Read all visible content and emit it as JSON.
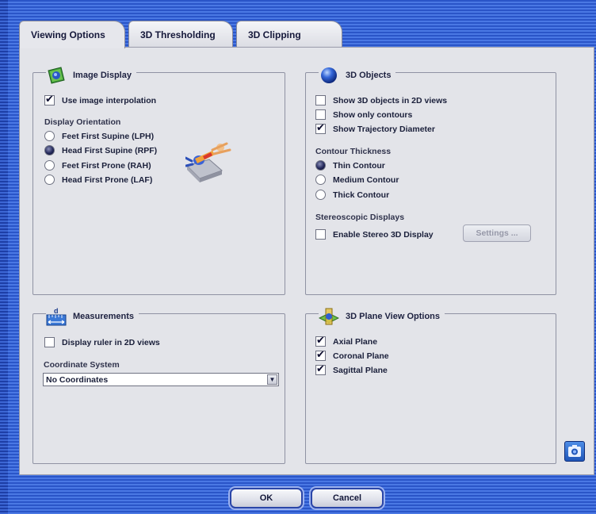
{
  "tabs": [
    {
      "label": "Viewing Options",
      "active": true
    },
    {
      "label": "3D Thresholding",
      "active": false
    },
    {
      "label": "3D Clipping",
      "active": false
    }
  ],
  "image_display": {
    "title": "Image Display",
    "interpolation": {
      "label": "Use image interpolation",
      "checked": true
    },
    "orientation_label": "Display Orientation",
    "orientations": [
      {
        "label": "Feet First Supine (LPH)",
        "selected": false
      },
      {
        "label": "Head First Supine (RPF)",
        "selected": true
      },
      {
        "label": "Feet First Prone (RAH)",
        "selected": false
      },
      {
        "label": "Head First Prone (LAF)",
        "selected": false
      }
    ]
  },
  "objects_3d": {
    "title": "3D Objects",
    "options": [
      {
        "label": "Show 3D objects in 2D views",
        "checked": false
      },
      {
        "label": "Show only contours",
        "checked": false
      },
      {
        "label": "Show Trajectory Diameter",
        "checked": true
      }
    ],
    "contour_label": "Contour Thickness",
    "contours": [
      {
        "label": "Thin Contour",
        "selected": true
      },
      {
        "label": "Medium Contour",
        "selected": false
      },
      {
        "label": "Thick Contour",
        "selected": false
      }
    ],
    "stereo_label": "Stereoscopic Displays",
    "stereo": {
      "label": "Enable Stereo 3D Display",
      "checked": false
    },
    "settings_button": "Settings ..."
  },
  "measurements": {
    "title": "Measurements",
    "ruler": {
      "label": "Display ruler in 2D views",
      "checked": false
    },
    "coord_label": "Coordinate System",
    "coord_value": "No Coordinates"
  },
  "plane_view": {
    "title": "3D Plane View Options",
    "planes": [
      {
        "label": "Axial Plane",
        "checked": true
      },
      {
        "label": "Coronal Plane",
        "checked": true
      },
      {
        "label": "Sagittal Plane",
        "checked": true
      }
    ]
  },
  "footer": {
    "ok": "OK",
    "cancel": "Cancel"
  },
  "icons": {
    "image_display": "image-display-icon",
    "objects_3d": "sphere-icon",
    "measurements": "ruler-icon",
    "plane_view": "plane-view-icon",
    "patient": "patient-orientation-icon",
    "camera": "camera-icon"
  }
}
